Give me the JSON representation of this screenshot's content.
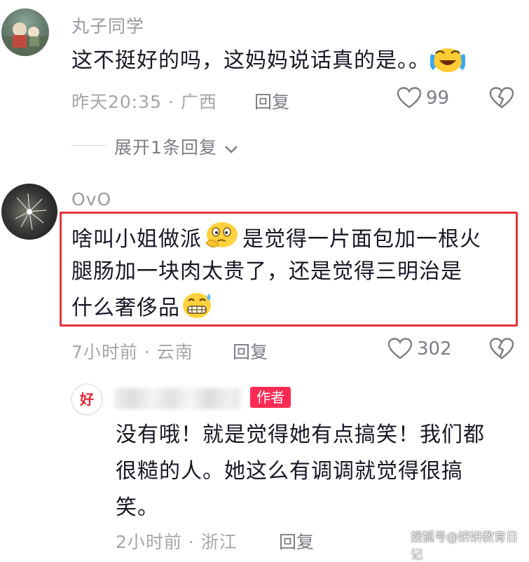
{
  "comments": [
    {
      "username": "丸子同学",
      "text": "这不挺好的吗，这妈妈说话真的是。。",
      "time": "昨天20:35 · 广西",
      "reply_label": "回复",
      "likes": "99",
      "expand_label": "展开1条回复"
    },
    {
      "username": "OvO",
      "text_line1_a": "啥叫小姐做派",
      "text_line1_b": "是觉得一片面包加一根火",
      "text_line2": "腿肠加一块肉太贵了，还是觉得三明治是",
      "text_line3": "什么奢侈品",
      "time": "7小时前 · 云南",
      "reply_label": "回复",
      "likes": "302"
    }
  ],
  "author_reply": {
    "avatar_char": "好",
    "badge": "作者",
    "text_line1": "没有哦！就是觉得她有点搞笑！我们都",
    "text_line2": "很糙的人。她这么有调调就觉得很搞",
    "text_line3": "笑。",
    "time": "2小时前 · 浙江",
    "reply_label": "回复"
  },
  "watermark": "搜狐号@妍妍教育日记",
  "colors": {
    "accent": "#fe2c55",
    "highlight_border": "#e8313d"
  }
}
